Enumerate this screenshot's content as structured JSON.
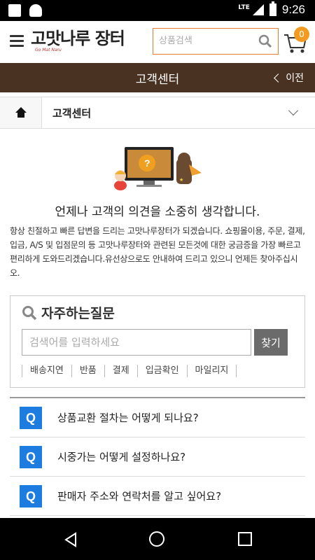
{
  "status_bar": {
    "network": "LTE",
    "time": "9:26"
  },
  "header": {
    "logo_main": "고맛나루",
    "logo_accent": "장터",
    "logo_sub": "Go Mat Naru",
    "search_placeholder": "상품검색",
    "cart_count": "0",
    "accent_color": "#e87b34"
  },
  "title_bar": {
    "title": "고객센터",
    "back_label": "이전",
    "bg_color": "#4a3223"
  },
  "breadcrumb": {
    "label": "고객센터"
  },
  "intro": {
    "headline": "언제나 고객의 의견을 소중히 생각합니다.",
    "description": "항상 친절하고 빠른 답변을 드리는 고맛나루장터가 되겠습니다. 쇼핑몰이용, 주문, 결제, 입금, A/S 및 입점문의 등 고맛나루장터와 관련된 모든것에 대한 궁금증을 가장 빠르고 편리하게 도와드리겠습니다.유선상으로도 안내하여 드리고 있으니 언제든 찾아주십시오."
  },
  "faq": {
    "title": "자주하는질문",
    "input_placeholder": "검색어를 입력하세요",
    "find_label": "찾기",
    "tags": [
      "배송지연",
      "반품",
      "결제",
      "입금확인",
      "마일리지"
    ]
  },
  "questions": [
    {
      "badge": "Q",
      "text": "상품교환 절차는 어떻게 되나요?"
    },
    {
      "badge": "Q",
      "text": "시중가는 어떻게 설정하나요?"
    },
    {
      "badge": "Q",
      "text": "판매자 주소와 연락처를 알고 싶어요?"
    }
  ]
}
